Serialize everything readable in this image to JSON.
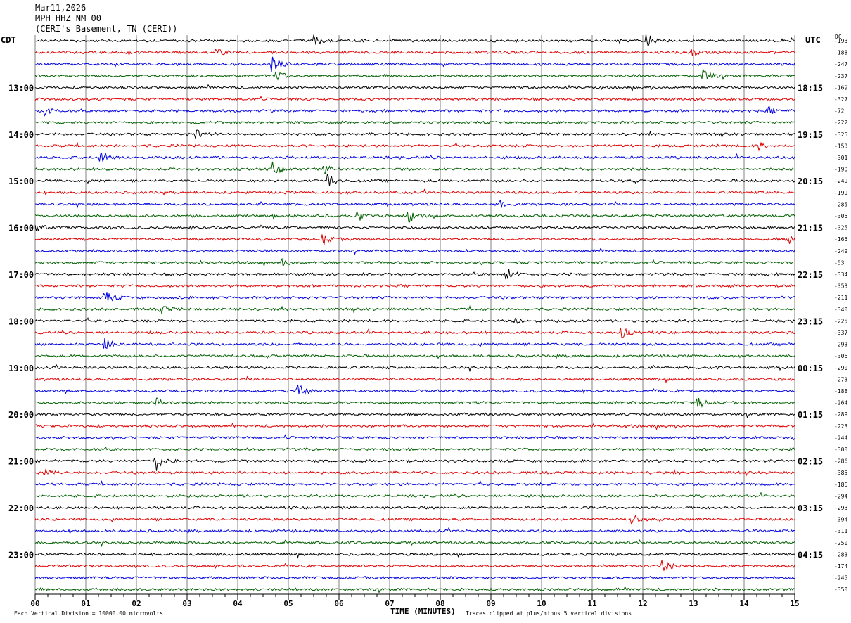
{
  "header": {
    "date": "Mar11,2026",
    "station": "MPH HHZ NM 00",
    "location": "(CERI's Basement, TN (CERI))"
  },
  "labels": {
    "left_tz": "CDT",
    "right_tz": "UTC",
    "dc": "DC"
  },
  "footer": {
    "scale_note": "Each Vertical Division = 10000.00 microvolts",
    "clip_note": "Traces clipped at plus/minus 5 vertical divisions"
  },
  "colors": {
    "trace_cycle": [
      "#000000",
      "#e00000",
      "#0000e0",
      "#006000"
    ],
    "grid": "#808080"
  },
  "chart_data": {
    "type": "line",
    "title": "",
    "xlabel": "TIME (MINUTES)",
    "xlim": [
      0,
      15
    ],
    "x_ticks": [
      "00",
      "01",
      "02",
      "03",
      "04",
      "05",
      "06",
      "07",
      "08",
      "09",
      "10",
      "11",
      "12",
      "13",
      "14",
      "15"
    ],
    "left_hour_labels": [
      {
        "row": 4,
        "label": "13:00"
      },
      {
        "row": 8,
        "label": "14:00"
      },
      {
        "row": 12,
        "label": "15:00"
      },
      {
        "row": 16,
        "label": "16:00"
      },
      {
        "row": 20,
        "label": "17:00"
      },
      {
        "row": 24,
        "label": "18:00"
      },
      {
        "row": 28,
        "label": "19:00"
      },
      {
        "row": 32,
        "label": "20:00"
      },
      {
        "row": 36,
        "label": "21:00"
      },
      {
        "row": 40,
        "label": "22:00"
      },
      {
        "row": 44,
        "label": "23:00"
      }
    ],
    "right_hour_labels": [
      {
        "row": 4,
        "label": "18:15"
      },
      {
        "row": 8,
        "label": "19:15"
      },
      {
        "row": 12,
        "label": "20:15"
      },
      {
        "row": 16,
        "label": "21:15"
      },
      {
        "row": 20,
        "label": "22:15"
      },
      {
        "row": 24,
        "label": "23:15"
      },
      {
        "row": 28,
        "label": "00:15"
      },
      {
        "row": 32,
        "label": "01:15"
      },
      {
        "row": 36,
        "label": "02:15"
      },
      {
        "row": 40,
        "label": "03:15"
      },
      {
        "row": 44,
        "label": "04:15"
      }
    ],
    "dc_offsets": [
      "-193",
      "-188",
      "-247",
      "-237",
      "-169",
      "-327",
      "-72",
      "-222",
      "-325",
      "-153",
      "-301",
      "-190",
      "-249",
      "-199",
      "-285",
      "-305",
      "-325",
      "-165",
      "-249",
      "-53",
      "-334",
      "-353",
      "-211",
      "-340",
      "-225",
      "-337",
      "-293",
      "-306",
      "-290",
      "-273",
      "-188",
      "-264",
      "-289",
      "-223",
      "-244",
      "-300",
      "-286",
      "-385",
      "-186",
      "-294",
      "-293",
      "-394",
      "-311",
      "-250",
      "-283",
      "-174",
      "-245",
      "-350"
    ],
    "events": [
      {
        "row": 0,
        "minute": 5.5,
        "amp": 8
      },
      {
        "row": 0,
        "minute": 12.1,
        "amp": 10
      },
      {
        "row": 1,
        "minute": 3.6,
        "amp": 5
      },
      {
        "row": 1,
        "minute": 13.0,
        "amp": 4
      },
      {
        "row": 2,
        "minute": 4.7,
        "amp": 12
      },
      {
        "row": 3,
        "minute": 4.8,
        "amp": 7
      },
      {
        "row": 3,
        "minute": 13.2,
        "amp": 10
      },
      {
        "row": 6,
        "minute": 0.2,
        "amp": 7
      },
      {
        "row": 6,
        "minute": 14.5,
        "amp": 4
      },
      {
        "row": 8,
        "minute": 3.2,
        "amp": 8
      },
      {
        "row": 9,
        "minute": 14.3,
        "amp": 5
      },
      {
        "row": 10,
        "minute": 1.3,
        "amp": 9
      },
      {
        "row": 11,
        "minute": 4.7,
        "amp": 9
      },
      {
        "row": 11,
        "minute": 5.7,
        "amp": 7
      },
      {
        "row": 12,
        "minute": 5.8,
        "amp": 10
      },
      {
        "row": 14,
        "minute": 9.2,
        "amp": 4
      },
      {
        "row": 15,
        "minute": 6.4,
        "amp": 8
      },
      {
        "row": 15,
        "minute": 7.4,
        "amp": 9
      },
      {
        "row": 16,
        "minute": 0.0,
        "amp": 7
      },
      {
        "row": 17,
        "minute": 5.7,
        "amp": 6
      },
      {
        "row": 17,
        "minute": 14.9,
        "amp": 6
      },
      {
        "row": 19,
        "minute": 4.9,
        "amp": 4
      },
      {
        "row": 20,
        "minute": 9.3,
        "amp": 12
      },
      {
        "row": 22,
        "minute": 1.4,
        "amp": 9
      },
      {
        "row": 23,
        "minute": 2.5,
        "amp": 6
      },
      {
        "row": 24,
        "minute": 9.5,
        "amp": 4
      },
      {
        "row": 25,
        "minute": 11.6,
        "amp": 7
      },
      {
        "row": 26,
        "minute": 1.4,
        "amp": 9
      },
      {
        "row": 30,
        "minute": 5.2,
        "amp": 10
      },
      {
        "row": 31,
        "minute": 2.4,
        "amp": 6
      },
      {
        "row": 31,
        "minute": 13.1,
        "amp": 7
      },
      {
        "row": 36,
        "minute": 2.4,
        "amp": 13
      },
      {
        "row": 37,
        "minute": 0.2,
        "amp": 5
      },
      {
        "row": 41,
        "minute": 11.8,
        "amp": 6
      },
      {
        "row": 45,
        "minute": 12.4,
        "amp": 8
      }
    ]
  }
}
